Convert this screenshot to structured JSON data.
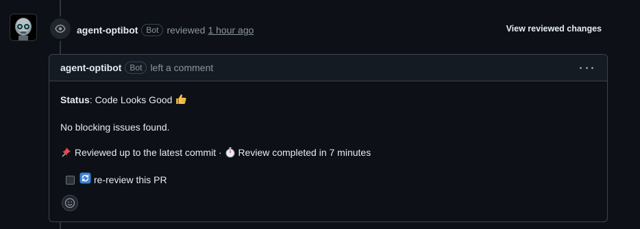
{
  "review": {
    "author": "agent-optibot",
    "bot_badge": "Bot",
    "action": "reviewed",
    "time": "1 hour ago",
    "view_changes_label": "View reviewed changes"
  },
  "comment": {
    "author": "agent-optibot",
    "bot_badge": "Bot",
    "action": "left a comment",
    "status_label": "Status",
    "status_value": ": Code Looks Good",
    "status_emoji": "thumbs-up",
    "no_issues": "No blocking issues found.",
    "reviewed_text": "Reviewed up to the latest commit · ",
    "completed_text": "Review completed in 7 minutes",
    "rereview_label": "re-review this PR"
  },
  "icons": {
    "avatar": "robot-avatar-icon",
    "review": "eye-icon",
    "menu": "kebab-menu-icon",
    "pin": "pushpin-icon",
    "timer": "stopwatch-icon",
    "refresh": "refresh-icon",
    "reaction": "smiley-icon"
  },
  "colors": {
    "background": "#0d1117",
    "header_bg": "#151b23",
    "border": "#3d444d",
    "text": "#e6edf3",
    "muted": "#8d96a0",
    "refresh_blue": "#3b82d6"
  }
}
